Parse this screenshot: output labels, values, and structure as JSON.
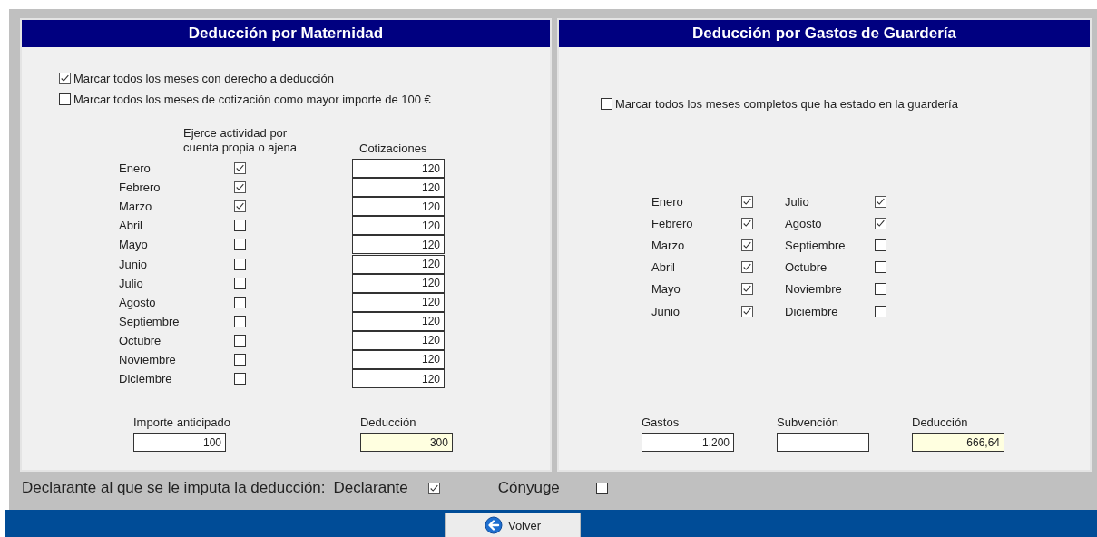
{
  "maternidad": {
    "title": "Deducción por Maternidad",
    "options": [
      {
        "label": "Marcar todos los meses con derecho a deducción",
        "checked": true
      },
      {
        "label": "Marcar todos los meses de cotización como mayor importe de 100 €",
        "checked": false
      }
    ],
    "activity_header": "Ejerce actividad por cuenta propia o ajena",
    "cotizaciones_header": "Cotizaciones",
    "months": [
      {
        "name": "Enero",
        "checked": true,
        "cotizacion": "120"
      },
      {
        "name": "Febrero",
        "checked": true,
        "cotizacion": "120"
      },
      {
        "name": "Marzo",
        "checked": true,
        "cotizacion": "120"
      },
      {
        "name": "Abril",
        "checked": false,
        "cotizacion": "120"
      },
      {
        "name": "Mayo",
        "checked": false,
        "cotizacion": "120"
      },
      {
        "name": "Junio",
        "checked": false,
        "cotizacion": "120"
      },
      {
        "name": "Julio",
        "checked": false,
        "cotizacion": "120"
      },
      {
        "name": "Agosto",
        "checked": false,
        "cotizacion": "120"
      },
      {
        "name": "Septiembre",
        "checked": false,
        "cotizacion": "120"
      },
      {
        "name": "Octubre",
        "checked": false,
        "cotizacion": "120"
      },
      {
        "name": "Noviembre",
        "checked": false,
        "cotizacion": "120"
      },
      {
        "name": "Diciembre",
        "checked": false,
        "cotizacion": "120"
      }
    ],
    "fields": [
      {
        "label": "Importe anticipado",
        "value": "100",
        "readonly": false
      },
      {
        "label": "Deducción",
        "value": "300",
        "readonly": true
      }
    ]
  },
  "guarderia": {
    "title": "Deducción por Gastos de Guardería",
    "option": {
      "label": "Marcar todos los meses completos que ha estado en la guardería",
      "checked": false
    },
    "months": [
      {
        "name": "Enero",
        "checked": true
      },
      {
        "name": "Febrero",
        "checked": true
      },
      {
        "name": "Marzo",
        "checked": true
      },
      {
        "name": "Abril",
        "checked": true
      },
      {
        "name": "Mayo",
        "checked": true
      },
      {
        "name": "Junio",
        "checked": true
      },
      {
        "name": "Julio",
        "checked": true
      },
      {
        "name": "Agosto",
        "checked": true
      },
      {
        "name": "Septiembre",
        "checked": false
      },
      {
        "name": "Octubre",
        "checked": false
      },
      {
        "name": "Noviembre",
        "checked": false
      },
      {
        "name": "Diciembre",
        "checked": false
      }
    ],
    "fields": [
      {
        "label": "Gastos",
        "value": "1.200",
        "readonly": false
      },
      {
        "label": "Subvención",
        "readonly": false
      },
      {
        "label": "Deducción",
        "value": "666,64",
        "readonly": true
      }
    ]
  },
  "declarante": {
    "label": "Declarante al que se le imputa la deducción:",
    "options": [
      {
        "label": "Declarante",
        "checked": true
      },
      {
        "label": "Cónyuge",
        "checked": false
      }
    ]
  },
  "back_button": {
    "label": "Volver"
  }
}
